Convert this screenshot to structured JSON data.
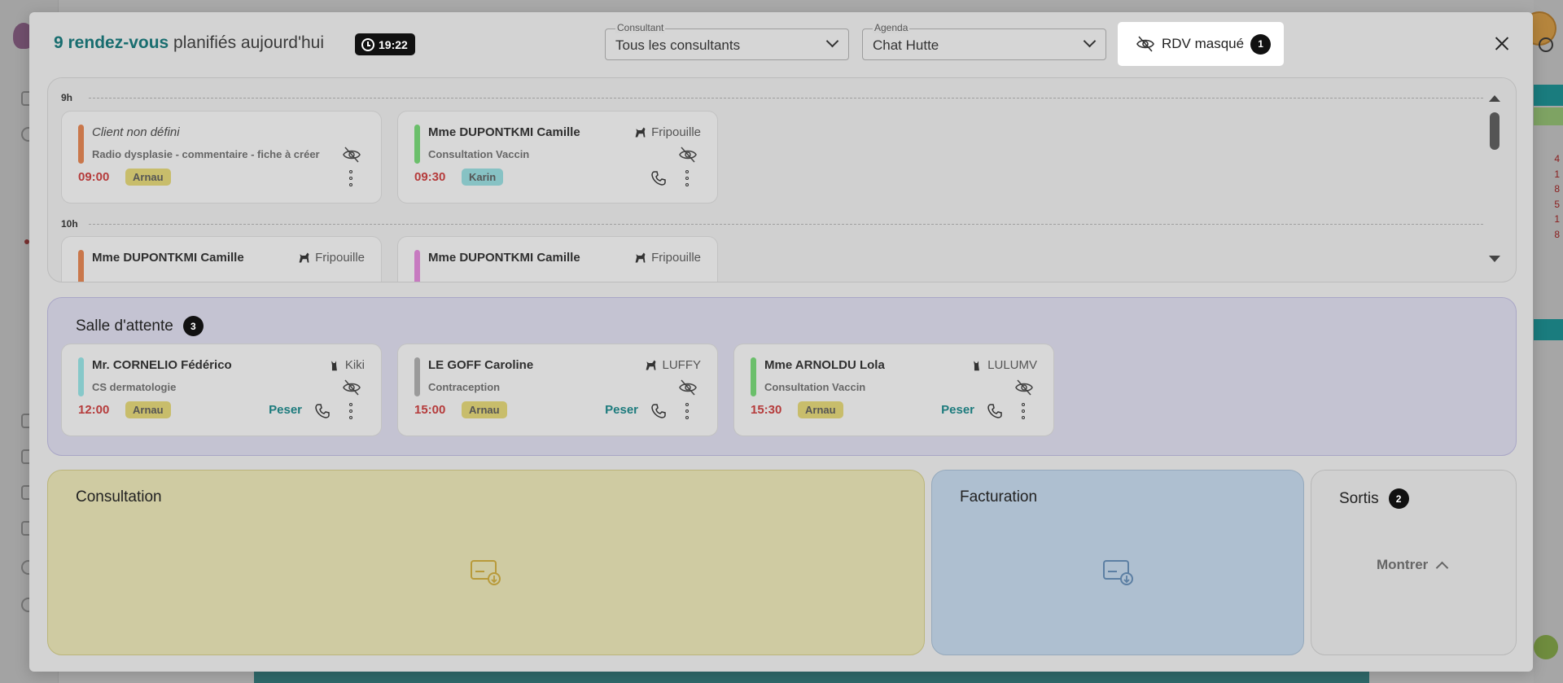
{
  "header": {
    "count_text": "9 rendez-vous",
    "title_rest": " planifiés aujourd'hui",
    "time": "19:22",
    "consultant_label": "Consultant",
    "consultant_value": "Tous les consultants",
    "agenda_label": "Agenda",
    "agenda_value": "Chat Hutte",
    "masked_label": "RDV masqué",
    "masked_count": "1"
  },
  "planning": {
    "hours": [
      "9h",
      "10h"
    ],
    "cards": [
      {
        "name": "Client non défini",
        "pet": "",
        "motif": "Radio dysplasie - commentaire - fiche à créer",
        "time": "09:00",
        "who": "Arnau",
        "color": "#c9774b"
      },
      {
        "name": "Mme DUPONTKMI Camille",
        "pet": "Fripouille",
        "motif": "Consultation Vaccin",
        "time": "09:30",
        "who": "Karin",
        "color": "#6bbf6b"
      },
      {
        "name": "Mme DUPONTKMI Camille",
        "pet": "Fripouille",
        "motif": "",
        "time": "",
        "who": "",
        "color": "#c9774b"
      },
      {
        "name": "Mme DUPONTKMI Camille",
        "pet": "Fripouille",
        "motif": "",
        "time": "",
        "who": "",
        "color": "#c77ac0"
      }
    ]
  },
  "waiting": {
    "title": "Salle d'attente",
    "count": "3",
    "peser_label": "Peser",
    "cards": [
      {
        "name": "Mr. CORNELIO Fédérico",
        "pet": "Kiki",
        "motif": "CS dermatologie",
        "time": "12:00",
        "who": "Arnau",
        "color": "#86c8c9"
      },
      {
        "name": "LE GOFF Caroline",
        "pet": "LUFFY",
        "motif": "Contraception",
        "time": "15:00",
        "who": "Arnau",
        "color": "#9a9a9a"
      },
      {
        "name": "Mme ARNOLDU Lola",
        "pet": "LULUMV",
        "motif": "Consultation Vaccin",
        "time": "15:30",
        "who": "Arnau",
        "color": "#6bbf6b"
      }
    ]
  },
  "panels": {
    "consultation_title": "Consultation",
    "facturation_title": "Facturation",
    "sortis_title": "Sortis",
    "sortis_count": "2",
    "show_label": "Montrer"
  },
  "colors": {
    "accent": "#186d6f",
    "time_red": "#b53b3b"
  }
}
